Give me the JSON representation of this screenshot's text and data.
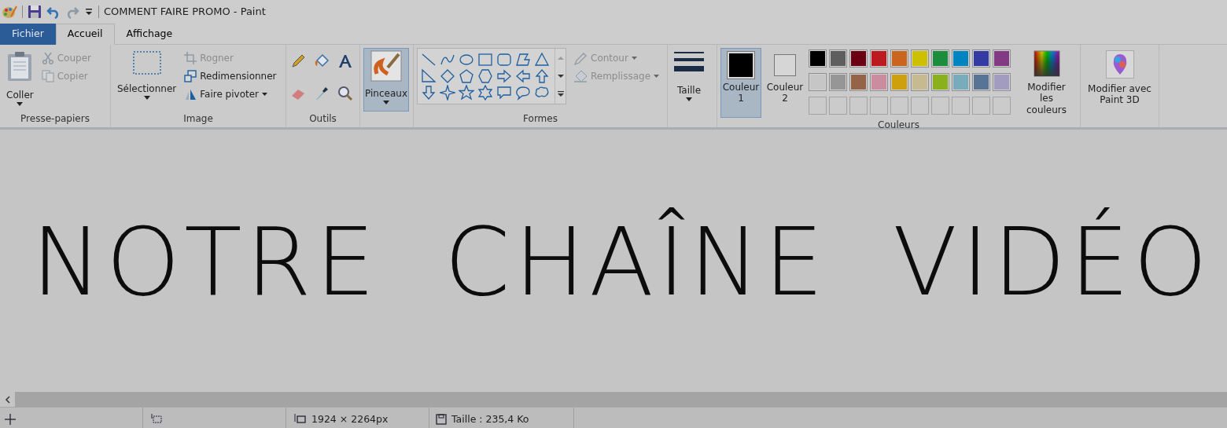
{
  "window": {
    "title": "COMMENT FAIRE PROMO - Paint"
  },
  "tabs": [
    {
      "label": "Fichier",
      "kind": "file",
      "selected": false
    },
    {
      "label": "Accueil",
      "kind": "tab",
      "selected": true
    },
    {
      "label": "Affichage",
      "kind": "tab",
      "selected": false
    }
  ],
  "ribbon": {
    "clipboard": {
      "label": "Presse-papiers",
      "paste": "Coller",
      "cut": {
        "label": "Couper",
        "disabled": true
      },
      "copy": {
        "label": "Copier",
        "disabled": true
      }
    },
    "image": {
      "label": "Image",
      "select": "Sélectionner",
      "crop": {
        "label": "Rogner",
        "disabled": true
      },
      "resize": {
        "label": "Redimensionner",
        "disabled": false
      },
      "rotate": {
        "label": "Faire pivoter",
        "disabled": false
      }
    },
    "tools": {
      "label": "Outils"
    },
    "brushes": {
      "label": "Pinceaux",
      "selected": true
    },
    "shapes": {
      "label": "Formes",
      "outline": {
        "label": "Contour",
        "disabled": true
      },
      "fill": {
        "label": "Remplissage",
        "disabled": true
      }
    },
    "size": {
      "label": "Taille"
    },
    "colors": {
      "label": "Couleurs",
      "color1": {
        "label": "Couleur 1",
        "selected": true,
        "color": "#000000"
      },
      "color2": {
        "label": "Couleur 2",
        "selected": false,
        "color": "#d6d6d6"
      },
      "palette": [
        {
          "color": "#000000"
        },
        {
          "color": "#5e5e5e"
        },
        {
          "color": "#6a0012"
        },
        {
          "color": "#bd1a20"
        },
        {
          "color": "#c9651f"
        },
        {
          "color": "#cdc000"
        },
        {
          "color": "#1c8c3d"
        },
        {
          "color": "#0084c0"
        },
        {
          "color": "#333aa3"
        },
        {
          "color": "#823a84"
        },
        {
          "color": "#c6c6c6"
        },
        {
          "color": "#969696"
        },
        {
          "color": "#956447"
        },
        {
          "color": "#cc8ca0"
        },
        {
          "color": "#cfa00e"
        },
        {
          "color": "#c6ba90"
        },
        {
          "color": "#8ab01c"
        },
        {
          "color": "#78acbc"
        },
        {
          "color": "#577396"
        },
        {
          "color": "#a29cc0"
        },
        {
          "kind": "empty"
        },
        {
          "kind": "empty"
        },
        {
          "kind": "empty"
        },
        {
          "kind": "empty"
        },
        {
          "kind": "empty"
        },
        {
          "kind": "empty"
        },
        {
          "kind": "empty"
        },
        {
          "kind": "empty"
        },
        {
          "kind": "empty"
        },
        {
          "kind": "empty"
        }
      ],
      "edit": "Modifier les couleurs"
    },
    "paint3d": {
      "label": "Modifier avec Paint 3D"
    }
  },
  "canvas": {
    "drawing_text": "NOTRE CHAÎNE VIDÉO"
  },
  "status_bar": {
    "dimensions": "1924 × 2264px",
    "size": "Taille : 235,4 Ko"
  }
}
